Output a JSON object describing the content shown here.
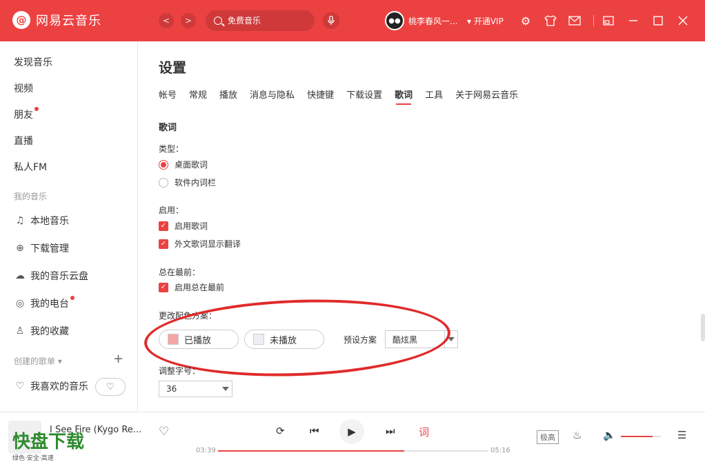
{
  "app": {
    "title": "网易云音乐",
    "logo_glyph": "@"
  },
  "header": {
    "back": "<",
    "forward": ">",
    "search_placeholder": "免费音乐",
    "username": "桃李春风一...",
    "vip": "开通VIP",
    "icons": [
      "mic-icon",
      "settings-icon",
      "skin-icon",
      "mail-icon",
      "mini-mode-icon",
      "minimize-icon",
      "maximize-icon",
      "close-icon"
    ]
  },
  "sidebar": {
    "items": [
      {
        "label": "发现音乐"
      },
      {
        "label": "视频"
      },
      {
        "label": "朋友"
      },
      {
        "label": "直播"
      },
      {
        "label": "私人FM"
      }
    ],
    "my_music_heading": "我的音乐",
    "my_music": [
      {
        "label": "本地音乐",
        "icon": "music-note-icon"
      },
      {
        "label": "下载管理",
        "icon": "download-icon"
      },
      {
        "label": "我的音乐云盘",
        "icon": "cloud-icon"
      },
      {
        "label": "我的电台",
        "icon": "radio-icon"
      },
      {
        "label": "我的收藏",
        "icon": "user-icon"
      }
    ],
    "created_heading": "创建的歌单",
    "liked": "我喜欢的音乐"
  },
  "settings": {
    "title": "设置",
    "tabs": [
      "帐号",
      "常规",
      "播放",
      "消息与隐私",
      "快捷键",
      "下载设置",
      "歌词",
      "工具",
      "关于网易云音乐"
    ],
    "active_tab": "歌词",
    "section": "歌词",
    "type_label": "类型：",
    "type_options": [
      "桌面歌词",
      "软件内词栏"
    ],
    "enable_label": "启用：",
    "enable_options": [
      "启用歌词",
      "外文歌词显示翻译"
    ],
    "top_label": "总在最前：",
    "top_option": "启用总在最前",
    "color_label": "更改配色方案：",
    "played": "已播放",
    "unplayed": "未播放",
    "preset_label": "预设方案",
    "preset_value": "酷炫黑",
    "font_label": "调整字号：",
    "font_value": "36"
  },
  "player": {
    "song": "I See Fire (Kygo Re...",
    "current": "03:39",
    "total": "05:16",
    "progress": 0.69,
    "quality": "极高",
    "volume": 0.8
  },
  "watermark": {
    "big": "快盘下载",
    "small": "绿色·安全·高速"
  },
  "colors": {
    "accent": "#ec4141",
    "played_swatch": "#f5a5a5",
    "unplayed_swatch": "#eeeef5"
  }
}
